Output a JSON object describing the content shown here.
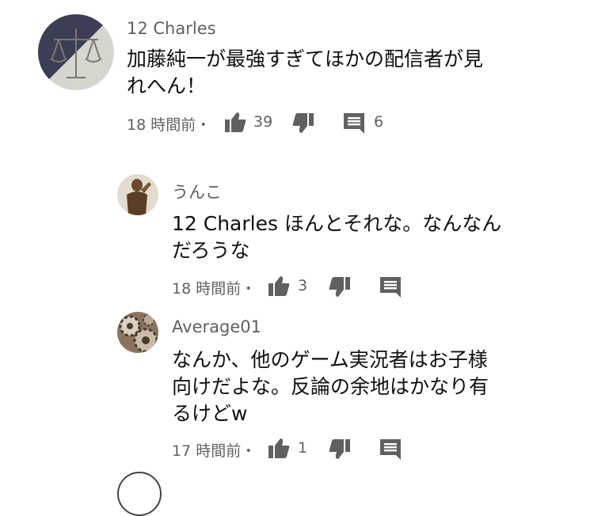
{
  "comments": [
    {
      "author": "12 Charles",
      "text_lines": [
        "加藤純一が最強すぎてほかの配信者が見",
        "れへん！"
      ],
      "time": "18 時間前・",
      "likes": "39",
      "replies": "6"
    },
    {
      "author": "うんこ",
      "text_lines": [
        "12 Charles ほんとそれな。なんなん",
        "だろうな"
      ],
      "time": "18 時間前・",
      "likes": "3"
    },
    {
      "author": "Average01",
      "text_lines": [
        "なんか、他のゲーム実況者はお子様",
        "向けだよな。反論の余地はかなり有",
        "るけどw"
      ],
      "time": "17 時間前・",
      "likes": "1"
    }
  ],
  "icons": {
    "like": "thumb-up-icon",
    "dislike": "thumb-down-icon",
    "reply": "comment-icon"
  }
}
